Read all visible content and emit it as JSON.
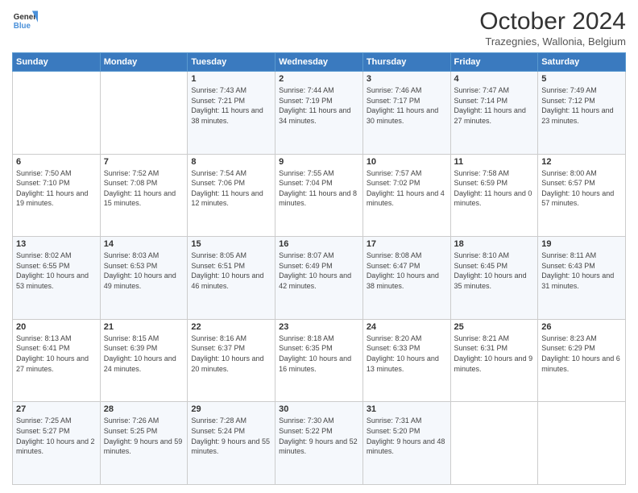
{
  "header": {
    "logo_line1": "General",
    "logo_line2": "Blue",
    "month": "October 2024",
    "location": "Trazegnies, Wallonia, Belgium"
  },
  "days_of_week": [
    "Sunday",
    "Monday",
    "Tuesday",
    "Wednesday",
    "Thursday",
    "Friday",
    "Saturday"
  ],
  "weeks": [
    [
      {
        "day": "",
        "sunrise": "",
        "sunset": "",
        "daylight": ""
      },
      {
        "day": "",
        "sunrise": "",
        "sunset": "",
        "daylight": ""
      },
      {
        "day": "1",
        "sunrise": "Sunrise: 7:43 AM",
        "sunset": "Sunset: 7:21 PM",
        "daylight": "Daylight: 11 hours and 38 minutes."
      },
      {
        "day": "2",
        "sunrise": "Sunrise: 7:44 AM",
        "sunset": "Sunset: 7:19 PM",
        "daylight": "Daylight: 11 hours and 34 minutes."
      },
      {
        "day": "3",
        "sunrise": "Sunrise: 7:46 AM",
        "sunset": "Sunset: 7:17 PM",
        "daylight": "Daylight: 11 hours and 30 minutes."
      },
      {
        "day": "4",
        "sunrise": "Sunrise: 7:47 AM",
        "sunset": "Sunset: 7:14 PM",
        "daylight": "Daylight: 11 hours and 27 minutes."
      },
      {
        "day": "5",
        "sunrise": "Sunrise: 7:49 AM",
        "sunset": "Sunset: 7:12 PM",
        "daylight": "Daylight: 11 hours and 23 minutes."
      }
    ],
    [
      {
        "day": "6",
        "sunrise": "Sunrise: 7:50 AM",
        "sunset": "Sunset: 7:10 PM",
        "daylight": "Daylight: 11 hours and 19 minutes."
      },
      {
        "day": "7",
        "sunrise": "Sunrise: 7:52 AM",
        "sunset": "Sunset: 7:08 PM",
        "daylight": "Daylight: 11 hours and 15 minutes."
      },
      {
        "day": "8",
        "sunrise": "Sunrise: 7:54 AM",
        "sunset": "Sunset: 7:06 PM",
        "daylight": "Daylight: 11 hours and 12 minutes."
      },
      {
        "day": "9",
        "sunrise": "Sunrise: 7:55 AM",
        "sunset": "Sunset: 7:04 PM",
        "daylight": "Daylight: 11 hours and 8 minutes."
      },
      {
        "day": "10",
        "sunrise": "Sunrise: 7:57 AM",
        "sunset": "Sunset: 7:02 PM",
        "daylight": "Daylight: 11 hours and 4 minutes."
      },
      {
        "day": "11",
        "sunrise": "Sunrise: 7:58 AM",
        "sunset": "Sunset: 6:59 PM",
        "daylight": "Daylight: 11 hours and 0 minutes."
      },
      {
        "day": "12",
        "sunrise": "Sunrise: 8:00 AM",
        "sunset": "Sunset: 6:57 PM",
        "daylight": "Daylight: 10 hours and 57 minutes."
      }
    ],
    [
      {
        "day": "13",
        "sunrise": "Sunrise: 8:02 AM",
        "sunset": "Sunset: 6:55 PM",
        "daylight": "Daylight: 10 hours and 53 minutes."
      },
      {
        "day": "14",
        "sunrise": "Sunrise: 8:03 AM",
        "sunset": "Sunset: 6:53 PM",
        "daylight": "Daylight: 10 hours and 49 minutes."
      },
      {
        "day": "15",
        "sunrise": "Sunrise: 8:05 AM",
        "sunset": "Sunset: 6:51 PM",
        "daylight": "Daylight: 10 hours and 46 minutes."
      },
      {
        "day": "16",
        "sunrise": "Sunrise: 8:07 AM",
        "sunset": "Sunset: 6:49 PM",
        "daylight": "Daylight: 10 hours and 42 minutes."
      },
      {
        "day": "17",
        "sunrise": "Sunrise: 8:08 AM",
        "sunset": "Sunset: 6:47 PM",
        "daylight": "Daylight: 10 hours and 38 minutes."
      },
      {
        "day": "18",
        "sunrise": "Sunrise: 8:10 AM",
        "sunset": "Sunset: 6:45 PM",
        "daylight": "Daylight: 10 hours and 35 minutes."
      },
      {
        "day": "19",
        "sunrise": "Sunrise: 8:11 AM",
        "sunset": "Sunset: 6:43 PM",
        "daylight": "Daylight: 10 hours and 31 minutes."
      }
    ],
    [
      {
        "day": "20",
        "sunrise": "Sunrise: 8:13 AM",
        "sunset": "Sunset: 6:41 PM",
        "daylight": "Daylight: 10 hours and 27 minutes."
      },
      {
        "day": "21",
        "sunrise": "Sunrise: 8:15 AM",
        "sunset": "Sunset: 6:39 PM",
        "daylight": "Daylight: 10 hours and 24 minutes."
      },
      {
        "day": "22",
        "sunrise": "Sunrise: 8:16 AM",
        "sunset": "Sunset: 6:37 PM",
        "daylight": "Daylight: 10 hours and 20 minutes."
      },
      {
        "day": "23",
        "sunrise": "Sunrise: 8:18 AM",
        "sunset": "Sunset: 6:35 PM",
        "daylight": "Daylight: 10 hours and 16 minutes."
      },
      {
        "day": "24",
        "sunrise": "Sunrise: 8:20 AM",
        "sunset": "Sunset: 6:33 PM",
        "daylight": "Daylight: 10 hours and 13 minutes."
      },
      {
        "day": "25",
        "sunrise": "Sunrise: 8:21 AM",
        "sunset": "Sunset: 6:31 PM",
        "daylight": "Daylight: 10 hours and 9 minutes."
      },
      {
        "day": "26",
        "sunrise": "Sunrise: 8:23 AM",
        "sunset": "Sunset: 6:29 PM",
        "daylight": "Daylight: 10 hours and 6 minutes."
      }
    ],
    [
      {
        "day": "27",
        "sunrise": "Sunrise: 7:25 AM",
        "sunset": "Sunset: 5:27 PM",
        "daylight": "Daylight: 10 hours and 2 minutes."
      },
      {
        "day": "28",
        "sunrise": "Sunrise: 7:26 AM",
        "sunset": "Sunset: 5:25 PM",
        "daylight": "Daylight: 9 hours and 59 minutes."
      },
      {
        "day": "29",
        "sunrise": "Sunrise: 7:28 AM",
        "sunset": "Sunset: 5:24 PM",
        "daylight": "Daylight: 9 hours and 55 minutes."
      },
      {
        "day": "30",
        "sunrise": "Sunrise: 7:30 AM",
        "sunset": "Sunset: 5:22 PM",
        "daylight": "Daylight: 9 hours and 52 minutes."
      },
      {
        "day": "31",
        "sunrise": "Sunrise: 7:31 AM",
        "sunset": "Sunset: 5:20 PM",
        "daylight": "Daylight: 9 hours and 48 minutes."
      },
      {
        "day": "",
        "sunrise": "",
        "sunset": "",
        "daylight": ""
      },
      {
        "day": "",
        "sunrise": "",
        "sunset": "",
        "daylight": ""
      }
    ]
  ]
}
